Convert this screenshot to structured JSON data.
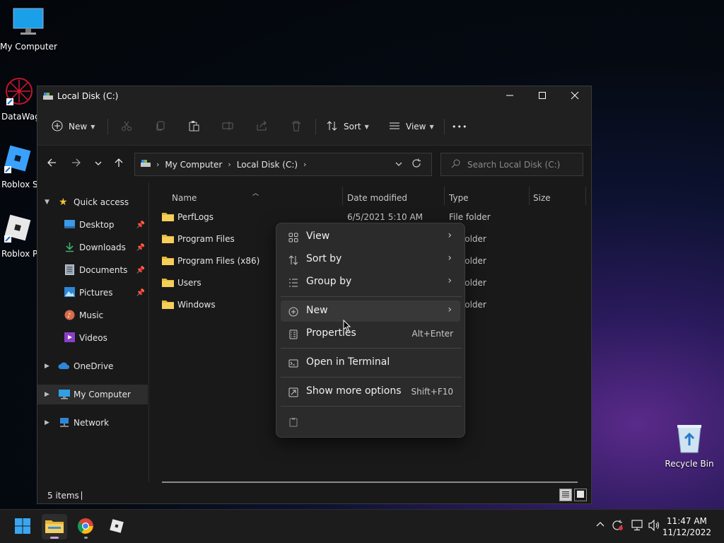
{
  "desktop": {
    "icons": [
      {
        "label": "My Computer"
      },
      {
        "label": "DataWag"
      },
      {
        "label": "Roblox St"
      },
      {
        "label": "Roblox Pl"
      },
      {
        "label": "Recycle Bin"
      }
    ]
  },
  "window": {
    "title": "Local Disk (C:)",
    "toolbar": {
      "new_label": "New",
      "sort_label": "Sort",
      "view_label": "View",
      "more_label": "•••"
    },
    "address": {
      "crumbs": [
        "My Computer",
        "Local Disk (C:)"
      ]
    },
    "search": {
      "placeholder": "Search Local Disk (C:)"
    },
    "sidebar": {
      "quick_access": "Quick access",
      "items": [
        {
          "label": "Desktop"
        },
        {
          "label": "Downloads"
        },
        {
          "label": "Documents"
        },
        {
          "label": "Pictures"
        },
        {
          "label": "Music"
        },
        {
          "label": "Videos"
        }
      ],
      "onedrive": "OneDrive",
      "my_computer": "My Computer",
      "network": "Network"
    },
    "columns": {
      "name": "Name",
      "date": "Date modified",
      "type": "Type",
      "size": "Size"
    },
    "files": [
      {
        "name": "PerfLogs",
        "date": "6/5/2021 5:10 AM",
        "type": "File folder"
      },
      {
        "name": "Program Files",
        "type": "folder"
      },
      {
        "name": "Program Files (x86)",
        "type": "folder"
      },
      {
        "name": "Users",
        "type": "folder"
      },
      {
        "name": "Windows",
        "type": "folder"
      }
    ],
    "status": "5 items"
  },
  "context_menu": {
    "view": "View",
    "sort_by": "Sort by",
    "group_by": "Group by",
    "new": "New",
    "properties": "Properties",
    "properties_shortcut": "Alt+Enter",
    "terminal": "Open in Terminal",
    "more_options": "Show more options",
    "more_options_shortcut": "Shift+F10"
  },
  "taskbar": {
    "time": "11:47 AM",
    "date": "11/12/2022"
  }
}
